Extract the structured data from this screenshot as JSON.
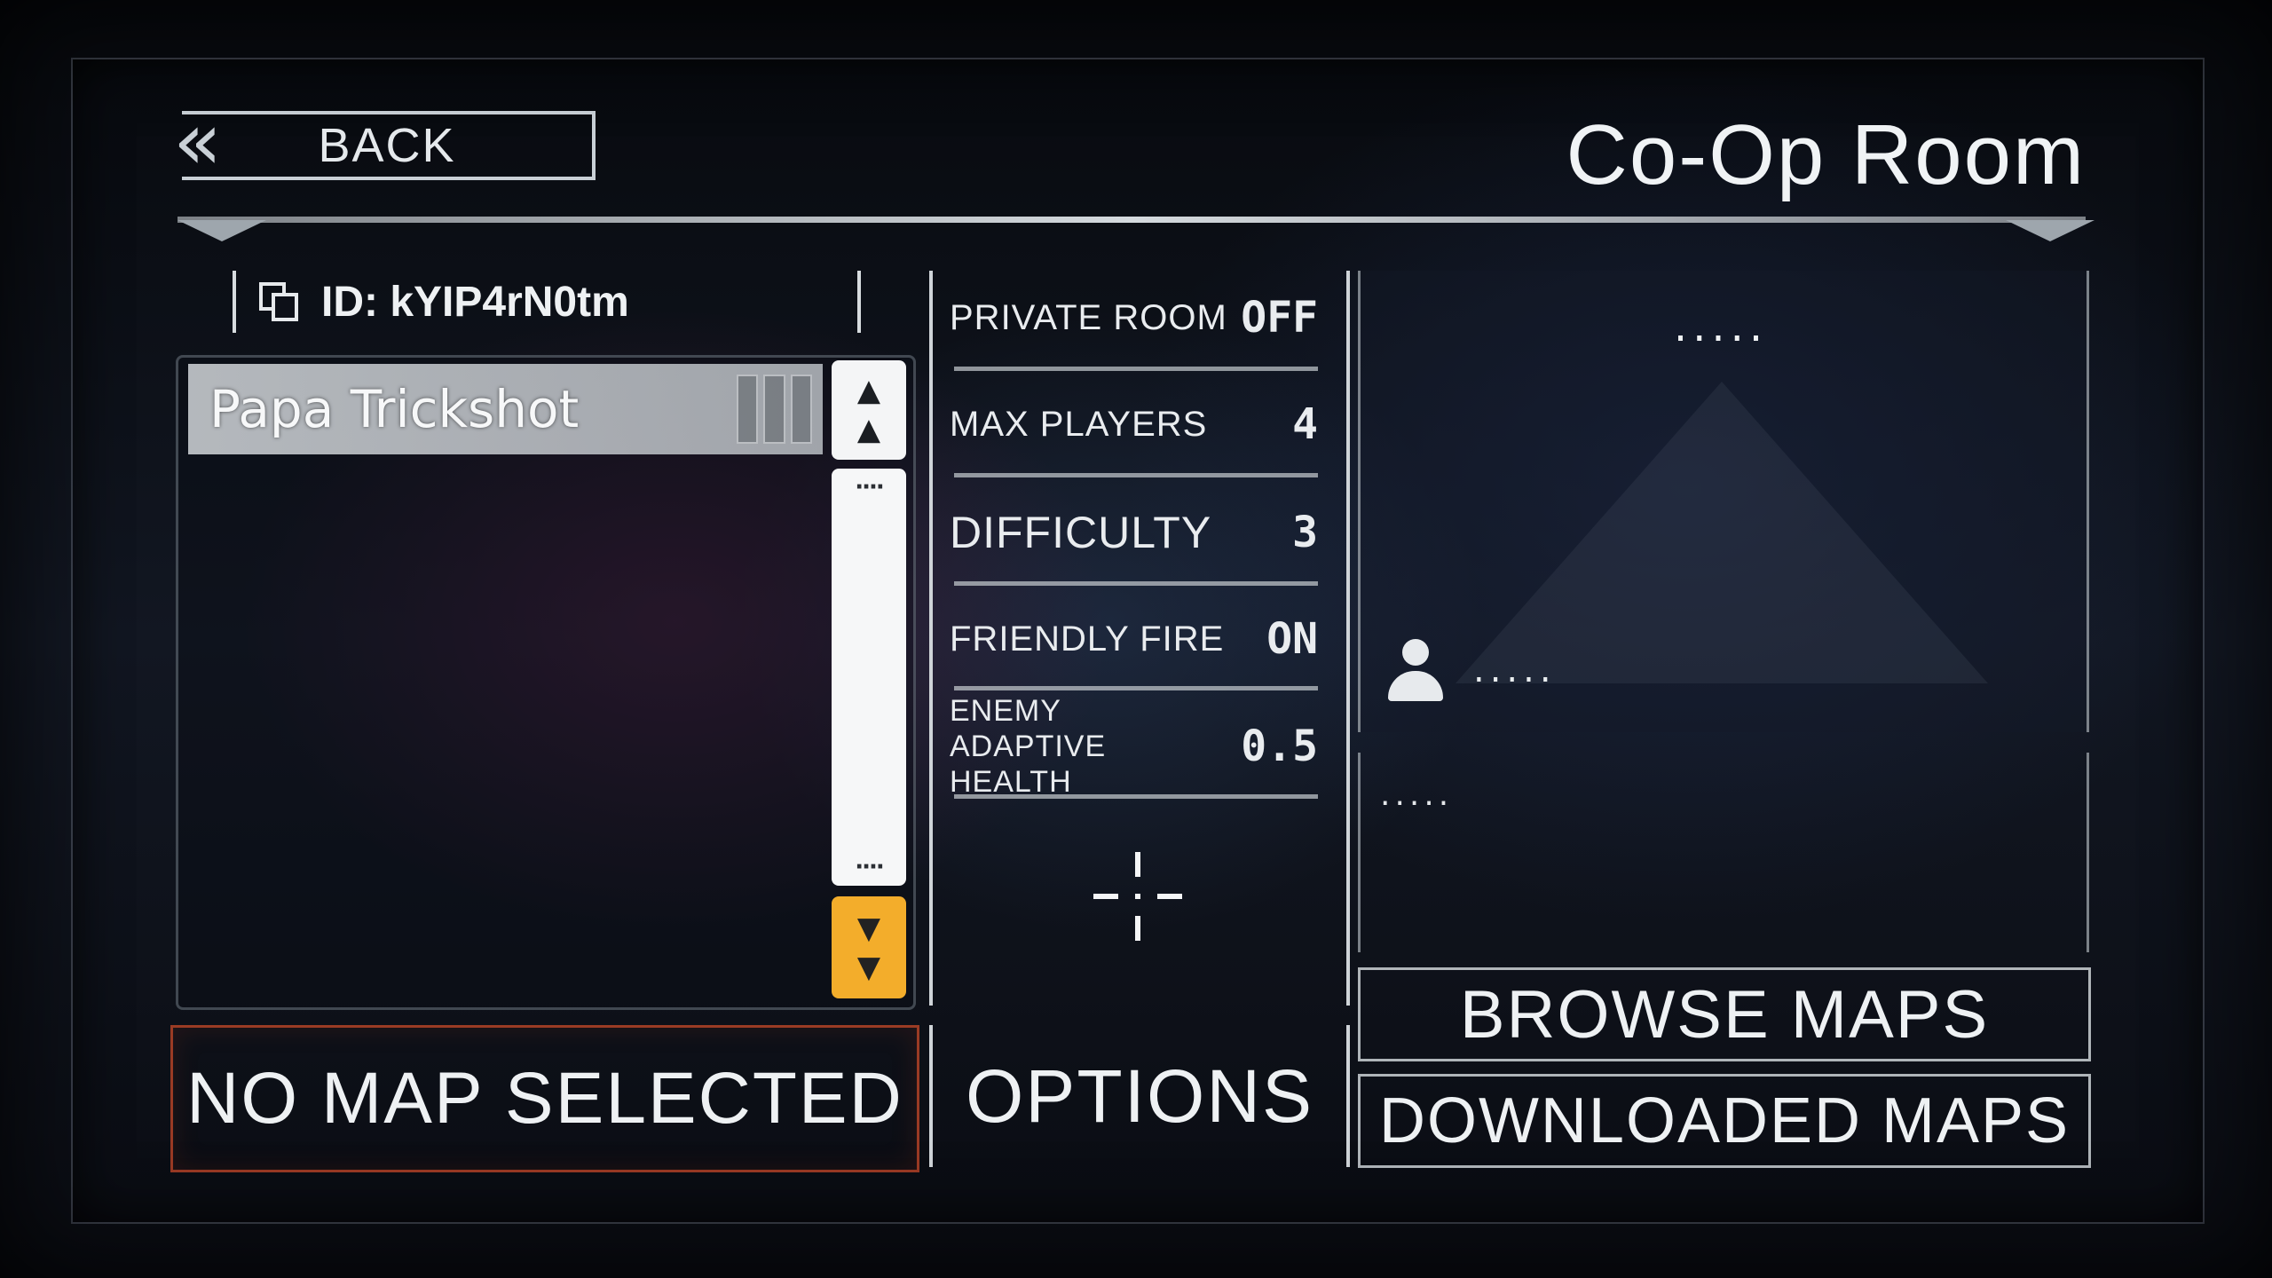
{
  "header": {
    "back_label": "BACK",
    "title": "Co-Op Room"
  },
  "room": {
    "id_text": "ID: kYIP4rN0tm",
    "copy_icon": "copy-icon"
  },
  "players": [
    {
      "name": "Papa Trickshot"
    }
  ],
  "scroll": {
    "dots": "····"
  },
  "map": {
    "selected_label": "NO MAP SELECTED"
  },
  "options": {
    "rows": [
      {
        "label": "PRIVATE ROOM",
        "value": "OFF"
      },
      {
        "label": "MAX PLAYERS",
        "value": "4"
      },
      {
        "label": "DIFFICULTY",
        "value": "3"
      },
      {
        "label": "FRIENDLY FIRE",
        "value": "ON"
      },
      {
        "label": "ENEMY ADAPTIVE HEALTH",
        "value": "0.5"
      }
    ],
    "button_label": "OPTIONS",
    "add_icon": "crosshair-icon"
  },
  "preview": {
    "title": ".....",
    "author": ".....",
    "description": "....."
  },
  "buttons": {
    "browse": "BROWSE MAPS",
    "downloaded": "DOWNLOADED MAPS"
  },
  "colors": {
    "accent_orange": "#f3ad2b",
    "map_border": "#be4628"
  }
}
